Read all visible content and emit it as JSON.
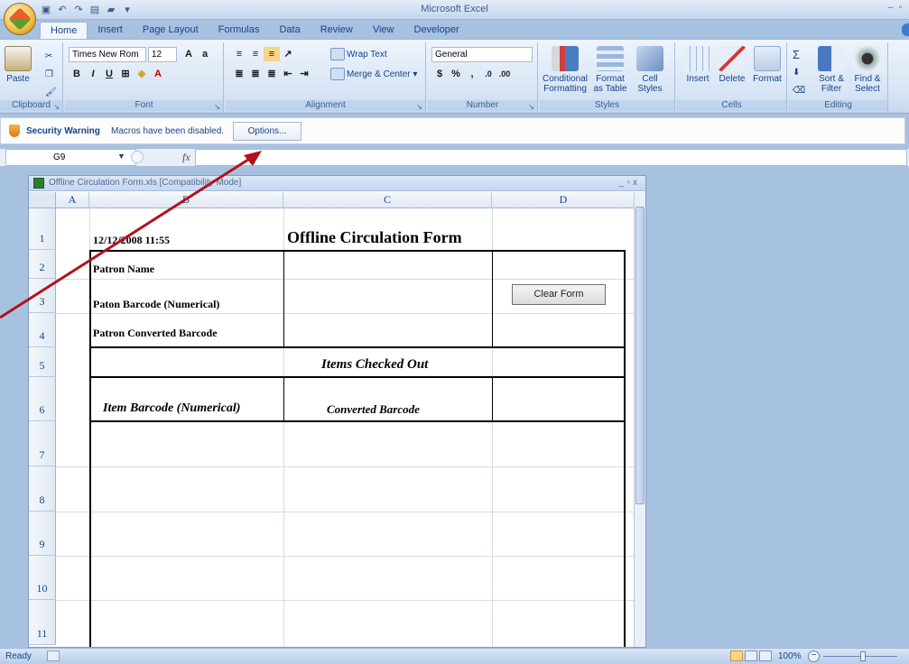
{
  "app": {
    "title": "Microsoft Excel",
    "tabs": [
      "Home",
      "Insert",
      "Page Layout",
      "Formulas",
      "Data",
      "Review",
      "View",
      "Developer"
    ]
  },
  "ribbon": {
    "clipboard": {
      "paste": "Paste",
      "label": "Clipboard"
    },
    "font": {
      "name": "Times New Rom",
      "size": "12",
      "label": "Font"
    },
    "alignment": {
      "wrap_text": "Wrap Text",
      "merge_center": "Merge & Center",
      "label": "Alignment"
    },
    "number": {
      "format": "General",
      "label": "Number",
      "currency": "$",
      "percent": "%",
      "comma": ","
    },
    "styles": {
      "conditional": "Conditional",
      "conditional2": "Formatting",
      "format_table": "Format",
      "format_table2": "as Table",
      "cell_styles": "Cell",
      "cell_styles2": "Styles",
      "label": "Styles"
    },
    "cells": {
      "insert": "Insert",
      "delete": "Delete",
      "format": "Format",
      "label": "Cells"
    },
    "editing": {
      "sort": "Sort &",
      "sort2": "Filter",
      "find": "Find &",
      "find2": "Select",
      "label": "Editing"
    }
  },
  "security": {
    "title": "Security Warning",
    "message": "Macros have been disabled.",
    "options": "Options..."
  },
  "formula_bar": {
    "name_box": "G9",
    "fx": "fx",
    "value": ""
  },
  "workbook": {
    "title": "Offline Circulation Form.xls  [Compatibility Mode]",
    "columns": [
      "A",
      "B",
      "C",
      "D"
    ],
    "rows": [
      "1",
      "2",
      "3",
      "4",
      "5",
      "6",
      "7",
      "8",
      "9",
      "10",
      "11"
    ],
    "cells": {
      "b1": "12/12/2008 11:55",
      "c1": "Offline Circulation Form",
      "b2": "Patron Name",
      "b3": "Paton Barcode (Numerical)",
      "b4": "Patron Converted Barcode",
      "c5": "Items Checked Out",
      "b6": "Item Barcode (Numerical)",
      "c6": "Converted Barcode"
    },
    "clear_button": "Clear Form"
  },
  "status": {
    "ready": "Ready",
    "zoom": "100%"
  },
  "colors": {
    "annotation_arrow": "#b3121a",
    "ribbon": "#d6e4f5",
    "workspace": "#a7c1e0"
  }
}
